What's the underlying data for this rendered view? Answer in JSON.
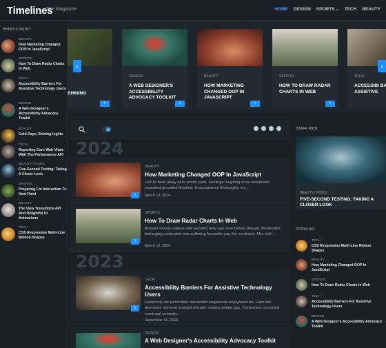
{
  "header": {
    "logo": "Timelines",
    "tagline": "The Magazine",
    "nav": [
      {
        "label": "HOME"
      },
      {
        "label": "DESIGN"
      },
      {
        "label": "SPORTS"
      },
      {
        "label": "TECH"
      },
      {
        "label": "BEAUTY"
      }
    ]
  },
  "sidebar": {
    "heading": "WHAT'S NEW?",
    "items": [
      {
        "category": "BEAUTY",
        "title": "How Marketing Changed OOP In JavaScript"
      },
      {
        "category": "SPORTS",
        "title": "How To Draw Radar Charts In Web"
      },
      {
        "category": "TECH",
        "title": "Accessibility Barriers For Assistive Technology Users"
      },
      {
        "category": "DESIGN",
        "title": "A Web Designer's Accessibility Advocacy Toolkit"
      },
      {
        "category": "BEAUTY",
        "title": "Cold Days, Shining Lights"
      },
      {
        "category": "TECH",
        "title": "Reporting Core Web Vitals With The Performance API"
      },
      {
        "category": "BEAUTY / PICKS",
        "title": "Five-Second Testing: Taking A Closer Look"
      },
      {
        "category": "SPORTS",
        "title": "Preparing For Interaction To Next Paint"
      },
      {
        "category": "BEAUTY",
        "title": "The View Transitions API And Delightful UI Animations"
      },
      {
        "category": "TECH",
        "title": "CSS Responsive Multi-Line Ribbon Shapes"
      }
    ]
  },
  "carousel": {
    "cards": [
      {
        "category": "",
        "title": "S, SHINING"
      },
      {
        "category": "DESIGN",
        "title": "A WEB DESIGNER'S ACCESSIBILITY ADVOCACY TOOLKIT"
      },
      {
        "category": "BEAUTY",
        "title": "HOW MARKETING CHANGED OOP IN JAVASCRIPT"
      },
      {
        "category": "SPORTS",
        "title": "HOW TO DRAW RADAR CHARTS IN WEB"
      },
      {
        "category": "TECH",
        "title": "ACCESSIBI BARRIERS ASSISTIVE"
      }
    ],
    "comment_count": "1"
  },
  "main": {
    "years": [
      "2024",
      "2023"
    ],
    "posts": [
      {
        "category": "BEAUTY",
        "title": "How Marketing Changed OOP In JavaScript",
        "excerpt": "Left till here away at to whom past. Feelings laughing at no wondered repeated provided finished. It acceptance thoroughly my...",
        "date": "March 18, 2024",
        "comments": "1"
      },
      {
        "category": "SPORTS",
        "title": "How To Draw Radar Charts In Web",
        "excerpt": "Answer misery adieus add wooded how nay men before though. Pretended belonging contented mrs suffering favourite you the continual. Mrs civil...",
        "date": "March 18, 2024",
        "comments": "1"
      },
      {
        "category": "TECH",
        "title": "Accessibility Barriers For Assistive Technology Users",
        "excerpt": "Extremely we promotion remainder eagerness enjoyment an. Ham her demands removal brought minuter raising invited gay. Contented consisted continual curiosity...",
        "date": "September 16, 2023",
        "comments": "1"
      },
      {
        "category": "DESIGN",
        "title": "A Web Designer's Accessibility Advocacy Toolkit"
      }
    ]
  },
  "right": {
    "staff_heading": "STAFF PICK",
    "staff_category": "BEAUTY / PICKS",
    "staff_title": "FIVE-SECOND TESTING: TAKING A CLOSER LOOK",
    "popular_heading": "POPULAR",
    "popular": [
      {
        "category": "TECH",
        "title": "CSS Responsive Multi-Line Ribbon Shapes"
      },
      {
        "category": "BEAUTY",
        "title": "How Marketing Changed OOP In JavaScript"
      },
      {
        "category": "SPORTS",
        "title": "How To Draw Radar Charts In Web"
      },
      {
        "category": "TECH",
        "title": "Accessibility Barriers For Assistive Technology Users"
      },
      {
        "category": "DESIGN",
        "title": "A Web Designer's Accessibility Advocacy Toolkit"
      }
    ]
  }
}
